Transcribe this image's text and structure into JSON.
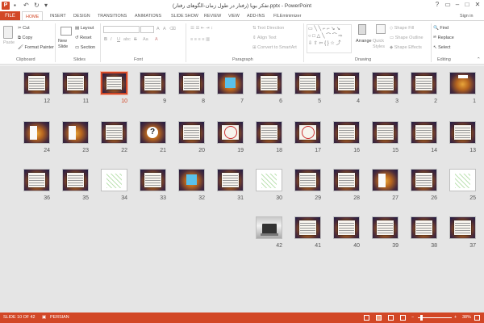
{
  "app": {
    "window_title": "تفکر بویا (رفتار در طول زمان-الگوهای رفتار).pptx - PowerPoint",
    "sign_in": "Sign in"
  },
  "qat": [
    "💾",
    "↶",
    "↻",
    "⊟"
  ],
  "window_buttons": [
    "?",
    "▣",
    "—",
    "☐",
    "✕"
  ],
  "tabs": [
    "FILE",
    "HOME",
    "INSERT",
    "DESIGN",
    "TRANSITIONS",
    "ANIMATIONS",
    "SLIDE SHOW",
    "REVIEW",
    "VIEW",
    "ADD-INS",
    "FILEminimizer"
  ],
  "active_tab": "HOME",
  "ribbon": {
    "clipboard": {
      "paste": "Paste",
      "cut": "Cut",
      "copy": "Copy",
      "format_painter": "Format Painter",
      "label": "Clipboard"
    },
    "slides": {
      "new_slide": "New Slide",
      "layout": "Layout",
      "reset": "Reset",
      "section": "Section",
      "label": "Slides"
    },
    "font": {
      "label": "Font",
      "bold": "B",
      "italic": "I",
      "underline": "U",
      "strike": "S",
      "shadow": "abc",
      "aa": "Aa",
      "a": "A"
    },
    "paragraph": {
      "text_direction": "Text Direction",
      "align_text": "Align Text",
      "convert_smartart": "Convert to SmartArt",
      "label": "Paragraph"
    },
    "drawing": {
      "arrange": "Arrange",
      "quick_styles": "Quick Styles",
      "shape_fill": "Shape Fill",
      "shape_outline": "Shape Outline",
      "shape_effects": "Shape Effects",
      "label": "Drawing"
    },
    "editing": {
      "find": "Find",
      "replace": "Replace",
      "select": "Select",
      "label": "Editing"
    }
  },
  "status": {
    "slide": "SLIDE 10 OF 42",
    "language": "PERSIAN",
    "zoom": "38%",
    "zoom_minus": "−",
    "zoom_plus": "+"
  },
  "selected_slide": "10",
  "slides": [
    {
      "n": "12",
      "kind": "text"
    },
    {
      "n": "11",
      "kind": "text"
    },
    {
      "n": "10",
      "kind": "text"
    },
    {
      "n": "9",
      "kind": "text"
    },
    {
      "n": "8",
      "kind": "text"
    },
    {
      "n": "7",
      "kind": "cyan"
    },
    {
      "n": "6",
      "kind": "text"
    },
    {
      "n": "5",
      "kind": "text"
    },
    {
      "n": "4",
      "kind": "text"
    },
    {
      "n": "3",
      "kind": "text"
    },
    {
      "n": "2",
      "kind": "text"
    },
    {
      "n": "1",
      "kind": "title"
    },
    {
      "n": "24",
      "kind": "white-block"
    },
    {
      "n": "23",
      "kind": "white-block"
    },
    {
      "n": "22",
      "kind": "text"
    },
    {
      "n": "21",
      "kind": "question"
    },
    {
      "n": "20",
      "kind": "text"
    },
    {
      "n": "19",
      "kind": "diagram"
    },
    {
      "n": "18",
      "kind": "text"
    },
    {
      "n": "17",
      "kind": "diagram"
    },
    {
      "n": "16",
      "kind": "text"
    },
    {
      "n": "15",
      "kind": "text"
    },
    {
      "n": "14",
      "kind": "text"
    },
    {
      "n": "13",
      "kind": "text"
    },
    {
      "n": "36",
      "kind": "text"
    },
    {
      "n": "35",
      "kind": "text"
    },
    {
      "n": "34",
      "kind": "chart"
    },
    {
      "n": "33",
      "kind": "text"
    },
    {
      "n": "32",
      "kind": "cyan"
    },
    {
      "n": "31",
      "kind": "text"
    },
    {
      "n": "30",
      "kind": "chart"
    },
    {
      "n": "29",
      "kind": "text"
    },
    {
      "n": "28",
      "kind": "text"
    },
    {
      "n": "27",
      "kind": "white-block"
    },
    {
      "n": "26",
      "kind": "text"
    },
    {
      "n": "25",
      "kind": "chart"
    },
    {
      "n": "42",
      "kind": "photo"
    },
    {
      "n": "41",
      "kind": "text"
    },
    {
      "n": "40",
      "kind": "text"
    },
    {
      "n": "39",
      "kind": "text"
    },
    {
      "n": "38",
      "kind": "text"
    },
    {
      "n": "37",
      "kind": "text"
    }
  ]
}
